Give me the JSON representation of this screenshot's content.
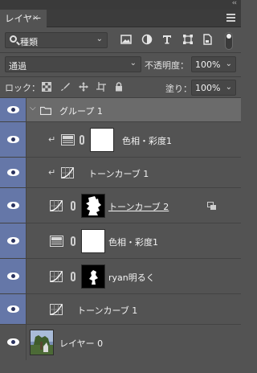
{
  "panel": {
    "tab_label": "レイヤー",
    "tab_close": "×",
    "collapse_glyph": "‹‹"
  },
  "filter": {
    "kind_value": "種類",
    "icons": [
      "image-filter-icon",
      "adjustment-filter-icon",
      "type-filter-icon",
      "shape-filter-icon",
      "smartobject-filter-icon"
    ]
  },
  "blend": {
    "mode_value": "通過",
    "opacity_label": "不透明度：",
    "opacity_value": "100%",
    "lock_label": "ロック：",
    "fill_label": "塗り：",
    "fill_value": "100%"
  },
  "layers": [
    {
      "name": "グループ 1",
      "kind": "group",
      "visible": true
    },
    {
      "name": "色相・彩度1",
      "kind": "hue-saturation",
      "visible": true,
      "clipped": true
    },
    {
      "name": "トーンカーブ 1",
      "kind": "curves",
      "visible": true,
      "clipped": true
    },
    {
      "name": "トーンカーブ 2",
      "kind": "curves",
      "visible": true,
      "underline": true
    },
    {
      "name": "色相・彩度1",
      "kind": "hue-saturation",
      "visible": true
    },
    {
      "name": "ryan明るく",
      "kind": "curves",
      "visible": true
    },
    {
      "name": "トーンカーブ 1",
      "kind": "curves",
      "visible": true
    },
    {
      "name": "レイヤー 0",
      "kind": "pixel",
      "visible": true
    }
  ],
  "colors": {
    "panel_bg": "#535353",
    "visibility_column": "#6577a8",
    "group_row": "#6b6b6b"
  }
}
